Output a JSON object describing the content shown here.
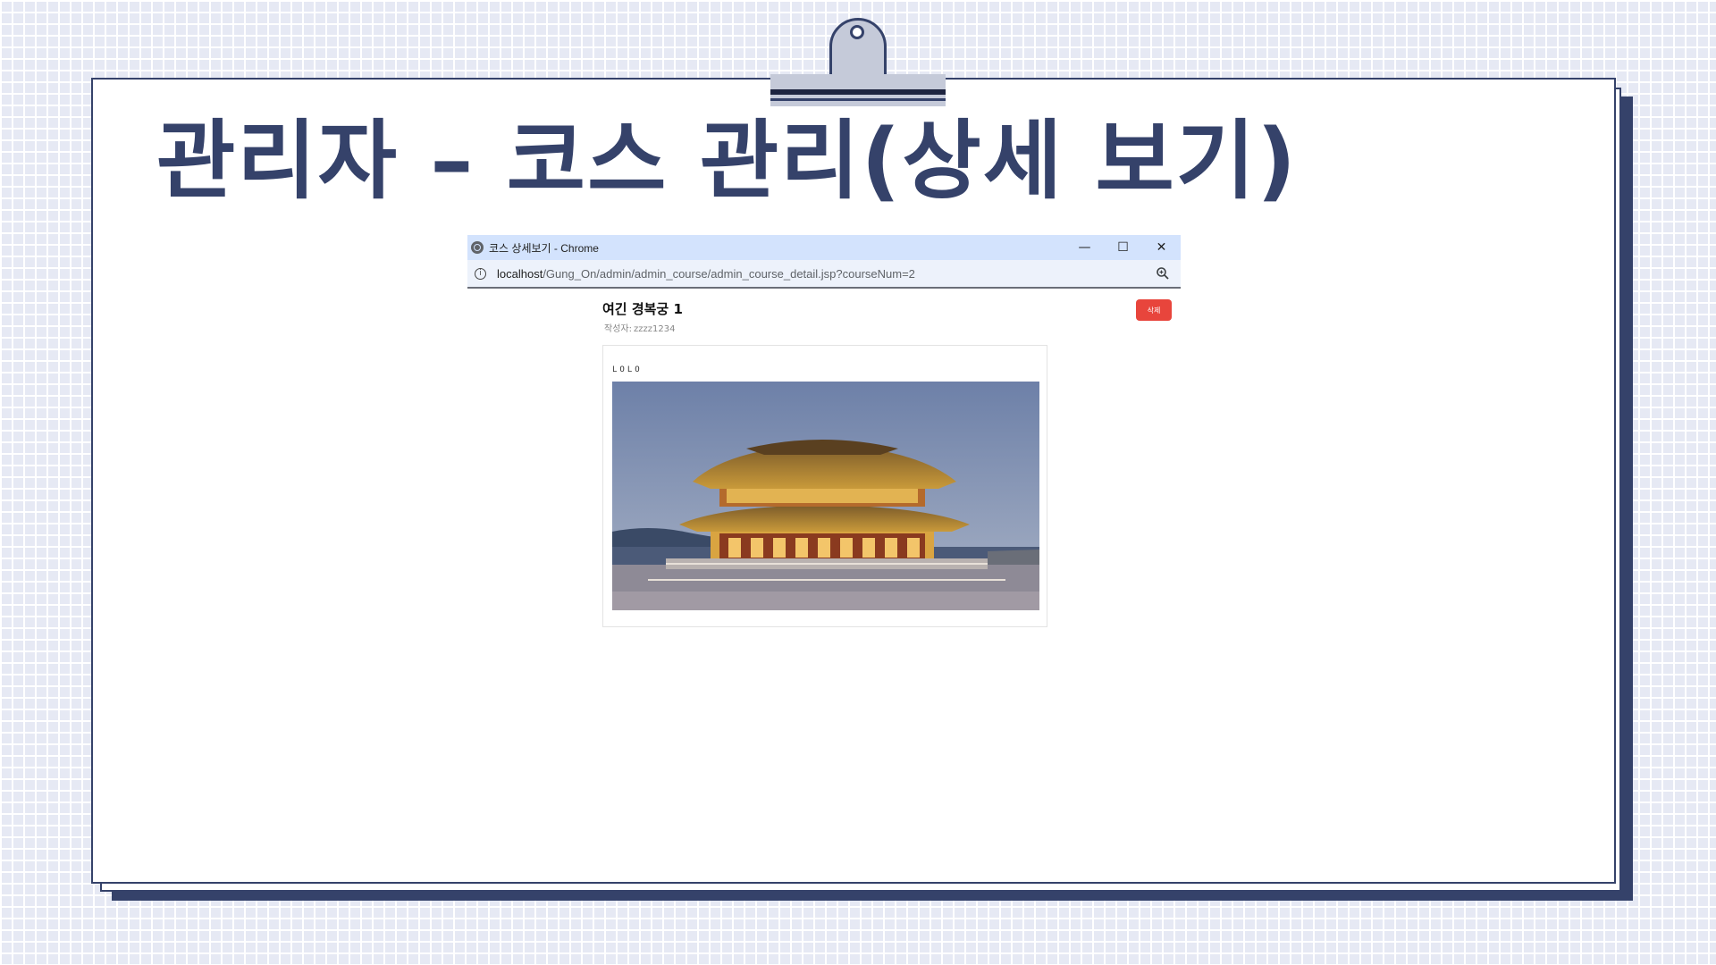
{
  "slide": {
    "title": "관리자 – 코스 관리(상세 보기)"
  },
  "window": {
    "title": "코스 상세보기 - Chrome",
    "controls": {
      "minimize": "—",
      "maximize": "☐",
      "close": "✕"
    },
    "address": {
      "host": "localhost",
      "path": "/Gung_On/admin/admin_course/admin_course_detail.jsp?courseNum=2"
    }
  },
  "course": {
    "title": "여긴 경복궁 1",
    "author_label": "작성자:",
    "author_value": "zzzz1234",
    "delete_label": "삭제",
    "logo_text": "LOLO"
  },
  "colors": {
    "accent": "#35426a",
    "delete": "#e8453c",
    "titlebar": "#d3e3fd"
  }
}
